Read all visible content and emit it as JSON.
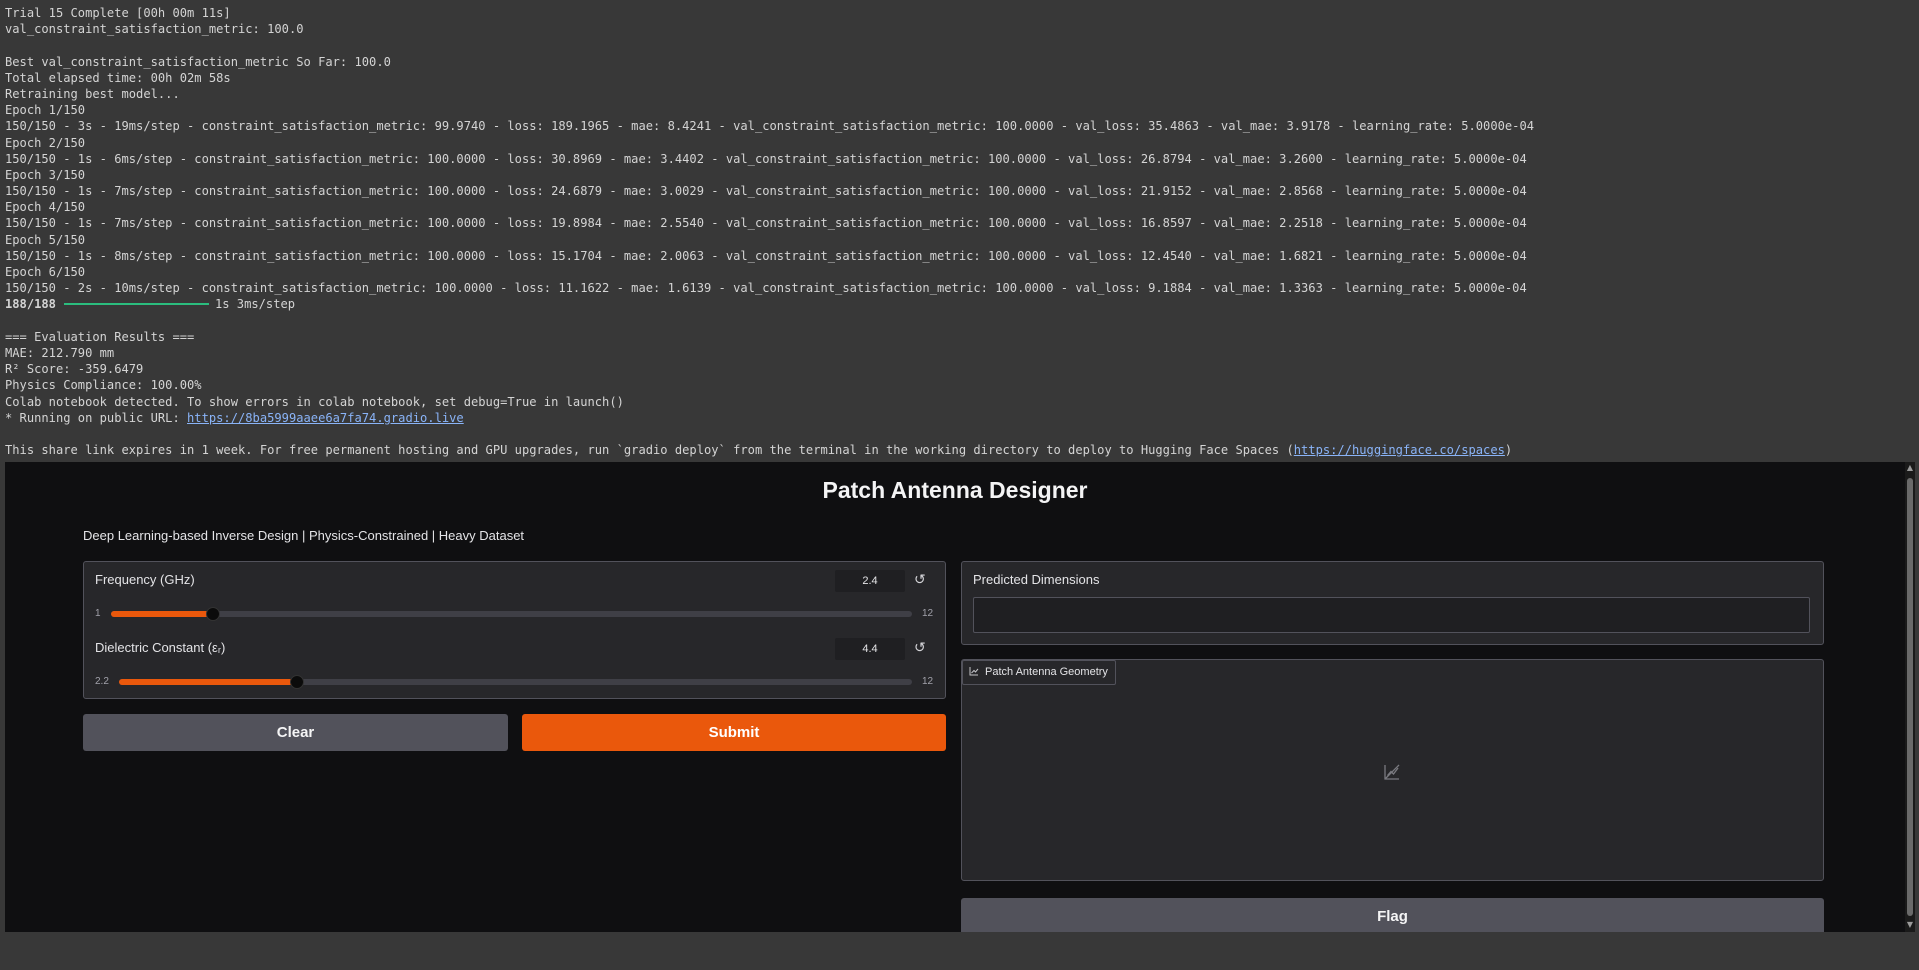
{
  "console": {
    "lines": [
      "Trial 15 Complete [00h 00m 11s]",
      "val_constraint_satisfaction_metric: 100.0",
      "",
      "Best val_constraint_satisfaction_metric So Far: 100.0",
      "Total elapsed time: 00h 02m 58s",
      "Retraining best model...",
      "Epoch 1/150",
      "150/150 - 3s - 19ms/step - constraint_satisfaction_metric: 99.9740 - loss: 189.1965 - mae: 8.4241 - val_constraint_satisfaction_metric: 100.0000 - val_loss: 35.4863 - val_mae: 3.9178 - learning_rate: 5.0000e-04",
      "Epoch 2/150",
      "150/150 - 1s - 6ms/step - constraint_satisfaction_metric: 100.0000 - loss: 30.8969 - mae: 3.4402 - val_constraint_satisfaction_metric: 100.0000 - val_loss: 26.8794 - val_mae: 3.2600 - learning_rate: 5.0000e-04",
      "Epoch 3/150",
      "150/150 - 1s - 7ms/step - constraint_satisfaction_metric: 100.0000 - loss: 24.6879 - mae: 3.0029 - val_constraint_satisfaction_metric: 100.0000 - val_loss: 21.9152 - val_mae: 2.8568 - learning_rate: 5.0000e-04",
      "Epoch 4/150",
      "150/150 - 1s - 7ms/step - constraint_satisfaction_metric: 100.0000 - loss: 19.8984 - mae: 2.5540 - val_constraint_satisfaction_metric: 100.0000 - val_loss: 16.8597 - val_mae: 2.2518 - learning_rate: 5.0000e-04",
      "Epoch 5/150",
      "150/150 - 1s - 8ms/step - constraint_satisfaction_metric: 100.0000 - loss: 15.1704 - mae: 2.0063 - val_constraint_satisfaction_metric: 100.0000 - val_loss: 12.4540 - val_mae: 1.6821 - learning_rate: 5.0000e-04",
      "Epoch 6/150",
      "150/150 - 2s - 10ms/step - constraint_satisfaction_metric: 100.0000 - loss: 11.1622 - mae: 1.6139 - val_constraint_satisfaction_metric: 100.0000 - val_loss: 9.1884 - val_mae: 1.3363 - learning_rate: 5.0000e-04"
    ],
    "progress_count": "188/188",
    "progress_rest": "1s 3ms/step",
    "lines2": [
      "",
      "=== Evaluation Results ===",
      "MAE: 212.790 mm",
      "R² Score: -359.6479",
      "Physics Compliance: 100.00%",
      "Colab notebook detected. To show errors in colab notebook, set debug=True in launch()"
    ],
    "running_prefix": "* Running on public URL: ",
    "running_url": "https://8ba5999aaee6a7fa74.gradio.live",
    "share_prefix": "This share link expires in 1 week. For free permanent hosting and GPU upgrades, run `gradio deploy` from the terminal in the working directory to deploy to Hugging Face Spaces (",
    "share_url": "https://huggingface.co/spaces",
    "share_suffix": ")"
  },
  "app": {
    "title": "Patch Antenna Designer",
    "subtitle": "Deep Learning-based Inverse Design | Physics-Constrained | Heavy Dataset",
    "frequency": {
      "label": "Frequency (GHz)",
      "value": "2.4",
      "min": "1",
      "max": "12",
      "level_fraction": 0.127
    },
    "dielectric": {
      "label": "Dielectric Constant (εᵣ)",
      "value": "4.4",
      "min": "2.2",
      "max": "12",
      "level_fraction": 0.225
    },
    "clear_label": "Clear",
    "submit_label": "Submit",
    "predicted_label": "Predicted Dimensions",
    "predicted_value": "",
    "plot_label": "Patch Antenna Geometry",
    "flag_label": "Flag",
    "colors": {
      "accent": "#ea580c",
      "background": "#0f0f11",
      "panel": "#27272a"
    },
    "icons": [
      "reset-icon",
      "chart-icon",
      "scroll-up-icon",
      "scroll-down-icon"
    ]
  }
}
